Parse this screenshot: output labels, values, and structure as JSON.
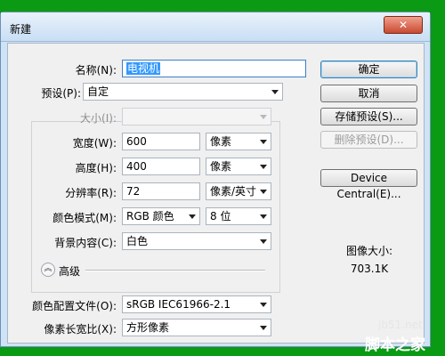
{
  "window": {
    "title": "新建",
    "close_icon": "close-icon"
  },
  "form": {
    "name": {
      "label": "名称(N):",
      "value": "电视机"
    },
    "preset": {
      "label": "预设(P):",
      "value": "自定"
    },
    "size": {
      "label": "大小(I):",
      "value": ""
    },
    "width": {
      "label": "宽度(W):",
      "value": "600",
      "unit": "像素"
    },
    "height": {
      "label": "高度(H):",
      "value": "400",
      "unit": "像素"
    },
    "resolution": {
      "label": "分辨率(R):",
      "value": "72",
      "unit": "像素/英寸"
    },
    "color_mode": {
      "label": "颜色模式(M):",
      "value": "RGB 颜色",
      "depth": "8 位"
    },
    "background": {
      "label": "背景内容(C):",
      "value": "白色"
    },
    "advanced": {
      "label": "高级",
      "icon": "double-chevron-up-icon"
    },
    "color_profile": {
      "label": "颜色配置文件(O):",
      "value": "sRGB IEC61966-2.1"
    },
    "pixel_aspect": {
      "label": "像素长宽比(X):",
      "value": "方形像素"
    }
  },
  "buttons": {
    "ok": "确定",
    "cancel": "取消",
    "save_preset": "存储预设(S)...",
    "delete_preset": "删除预设(D)...",
    "device_central": "Device Central(E)..."
  },
  "info": {
    "image_size_label": "图像大小:",
    "image_size_value": "703.1K"
  },
  "watermark": {
    "site": "jb51.net",
    "brand": "脚本之家"
  }
}
